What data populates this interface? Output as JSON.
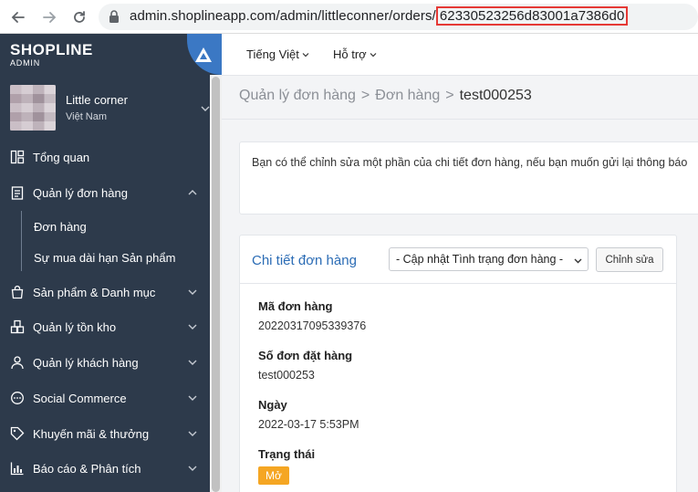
{
  "browser": {
    "url_prefix": "admin.shoplineapp.com/admin/littleconner/orders/",
    "url_highlight": "62330523256d83001a7386d0"
  },
  "sidebar": {
    "logo": "SHOPLINE",
    "logo_sub": "ADMIN",
    "store": {
      "name": "Little corner",
      "location": "Việt Nam"
    },
    "items": [
      {
        "label": "Tổng quan",
        "icon": "dashboard-icon"
      },
      {
        "label": "Quản lý đơn hàng",
        "icon": "clipboard-icon"
      },
      {
        "label": "Sản phẩm & Danh mục",
        "icon": "shopping-bag-icon"
      },
      {
        "label": "Quản lý tồn kho",
        "icon": "warehouse-icon"
      },
      {
        "label": "Quản lý khách hàng",
        "icon": "user-icon"
      },
      {
        "label": "Social Commerce",
        "icon": "chat-icon"
      },
      {
        "label": "Khuyến mãi & thưởng",
        "icon": "tag-icon"
      },
      {
        "label": "Báo cáo & Phân tích",
        "icon": "chart-icon"
      }
    ],
    "sub_items": [
      "Đơn hàng",
      "Sự mua dài hạn Sản phẩm"
    ]
  },
  "topbar": {
    "language": "Tiếng Việt",
    "support": "Hỗ trợ"
  },
  "breadcrumb": {
    "level1": "Quản lý đơn hàng",
    "level2": "Đơn hàng",
    "current": "test000253",
    "separator": ">"
  },
  "notice": "Bạn có thể chỉnh sửa một phần của chi tiết đơn hàng, nếu bạn muốn gửi lại thông báo",
  "order_card": {
    "title": "Chi tiết đơn hàng",
    "status_select": "- Cập nhật Tình trạng đơn hàng -",
    "edit_button": "Chỉnh sửa",
    "fields": [
      {
        "label": "Mã đơn hàng",
        "value": "20220317095339376"
      },
      {
        "label": "Số đơn đặt hàng",
        "value": "test000253"
      },
      {
        "label": "Ngày",
        "value": "2022-03-17 5:53PM"
      },
      {
        "label": "Trạng thái",
        "value": "Mở"
      }
    ]
  },
  "colors": {
    "sidebar_bg": "#2d3a4b",
    "accent_blue": "#2b6cb5",
    "badge_orange": "#f5a623",
    "url_highlight_border": "#e53935"
  }
}
